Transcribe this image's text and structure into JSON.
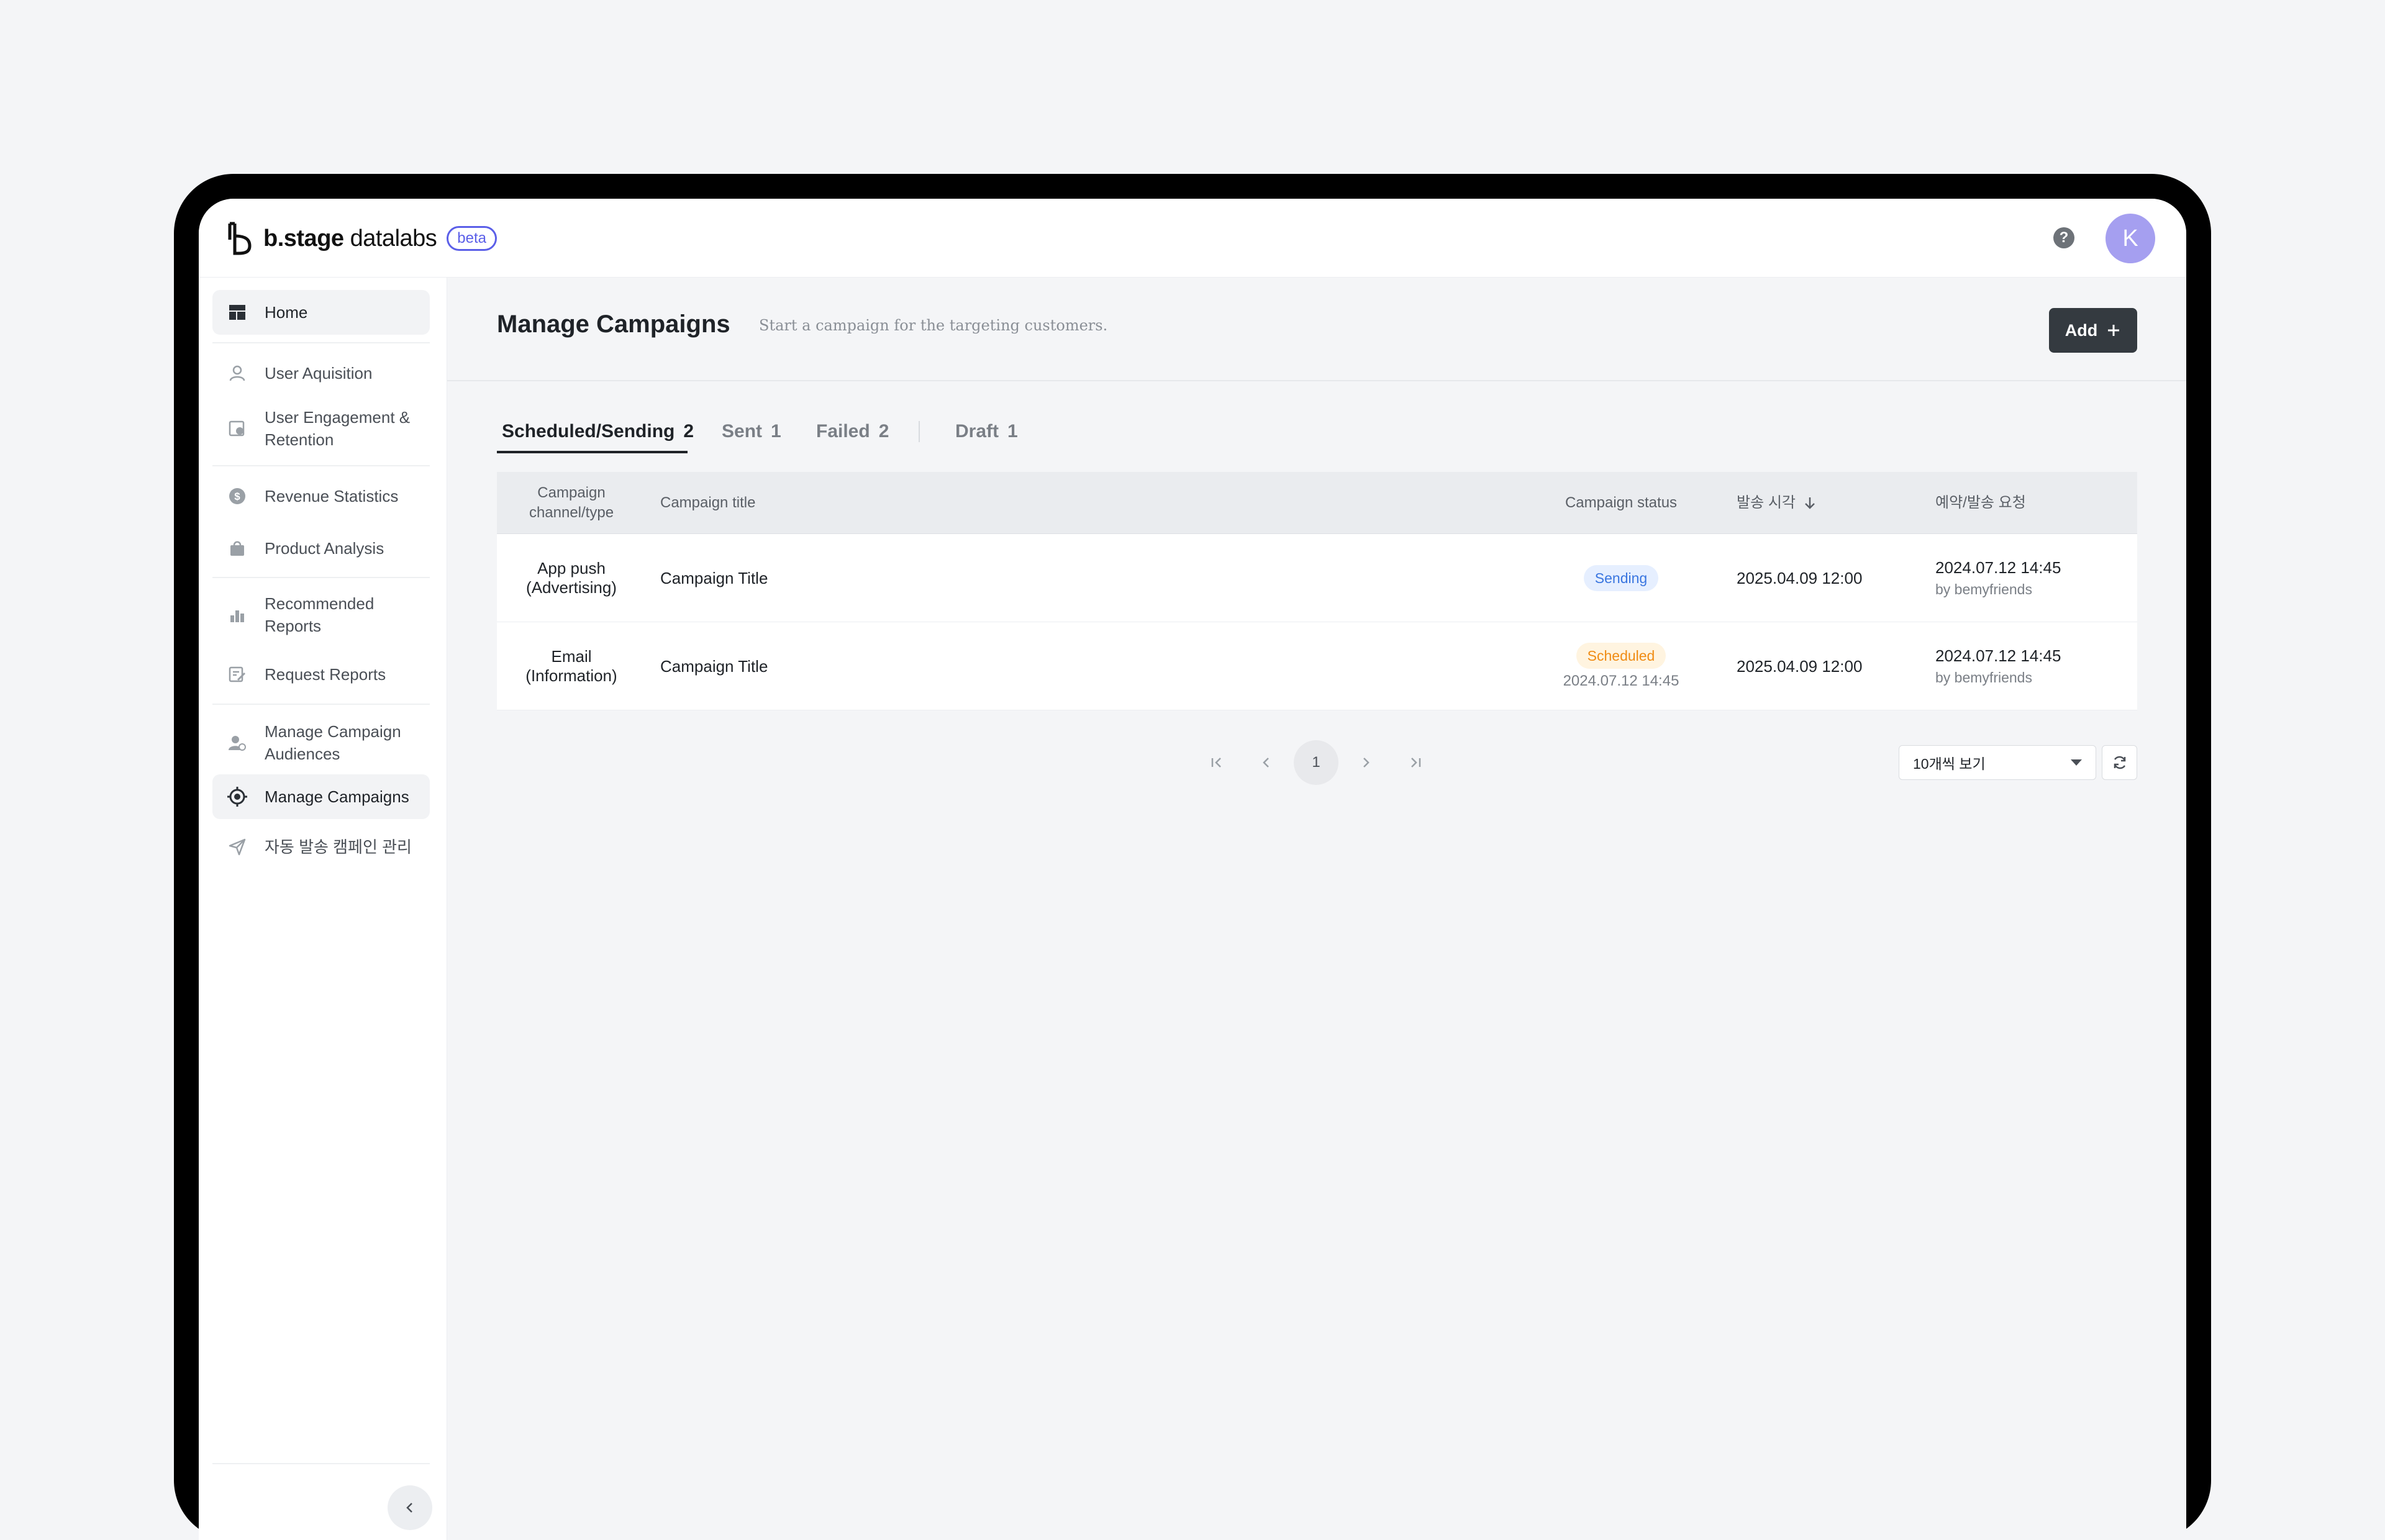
{
  "header": {
    "logo_bold": "b.stage",
    "logo_light": " datalabs",
    "beta_label": "beta",
    "help_label": "?",
    "avatar_initial": "K"
  },
  "sidebar": {
    "items": [
      {
        "label": "Home",
        "icon": "dashboard-icon",
        "active": true
      },
      {
        "label": "User Aquisition",
        "icon": "user-icon"
      },
      {
        "label": "User Engagement & Retention",
        "icon": "engagement-icon"
      },
      {
        "label": "Revenue Statistics",
        "icon": "dollar-icon"
      },
      {
        "label": "Product Analysis",
        "icon": "bag-icon"
      },
      {
        "label": "Recommended Reports",
        "icon": "bar-chart-icon"
      },
      {
        "label": "Request Reports",
        "icon": "edit-report-icon"
      },
      {
        "label": "Manage Campaign Audiences",
        "icon": "audience-icon"
      },
      {
        "label": "Manage Campaigns",
        "icon": "target-icon",
        "active": true
      },
      {
        "label": "자동 발송 캠페인 관리",
        "icon": "send-icon"
      }
    ]
  },
  "page": {
    "title": "Manage Campaigns",
    "subtitle": "Start a campaign for the targeting customers.",
    "add_label": "Add"
  },
  "tabs": [
    {
      "label": "Scheduled/Sending",
      "count": "2",
      "active": true
    },
    {
      "label": "Sent",
      "count": "1"
    },
    {
      "label": "Failed",
      "count": "2"
    },
    {
      "label": "Draft",
      "count": "1"
    }
  ],
  "table": {
    "headers": {
      "channel": "Campaign channel/type",
      "title": "Campaign title",
      "status": "Campaign status",
      "send_time": "발송 시각",
      "request": "예약/발송 요청"
    },
    "rows": [
      {
        "channel": "App push",
        "type": "(Advertising)",
        "title": "Campaign Title",
        "status": "Sending",
        "status_sub": "",
        "send_time": "2025.04.09 12:00",
        "request_time": "2024.07.12 14:45",
        "request_by": "by bemyfriends"
      },
      {
        "channel": "Email",
        "type": "(Information)",
        "title": "Campaign Title",
        "status": "Scheduled",
        "status_sub": "2024.07.12 14:45",
        "send_time": "2025.04.09 12:00",
        "request_time": "2024.07.12 14:45",
        "request_by": "by bemyfriends"
      }
    ]
  },
  "pagination": {
    "current_page": "1",
    "per_page": "10개씩 보기"
  },
  "colors": {
    "primary_button": "#343a40",
    "sending_badge": "#3a76e0",
    "scheduled_badge": "#f08c14",
    "beta": "#5b5fe8",
    "avatar": "#a59ff0"
  }
}
